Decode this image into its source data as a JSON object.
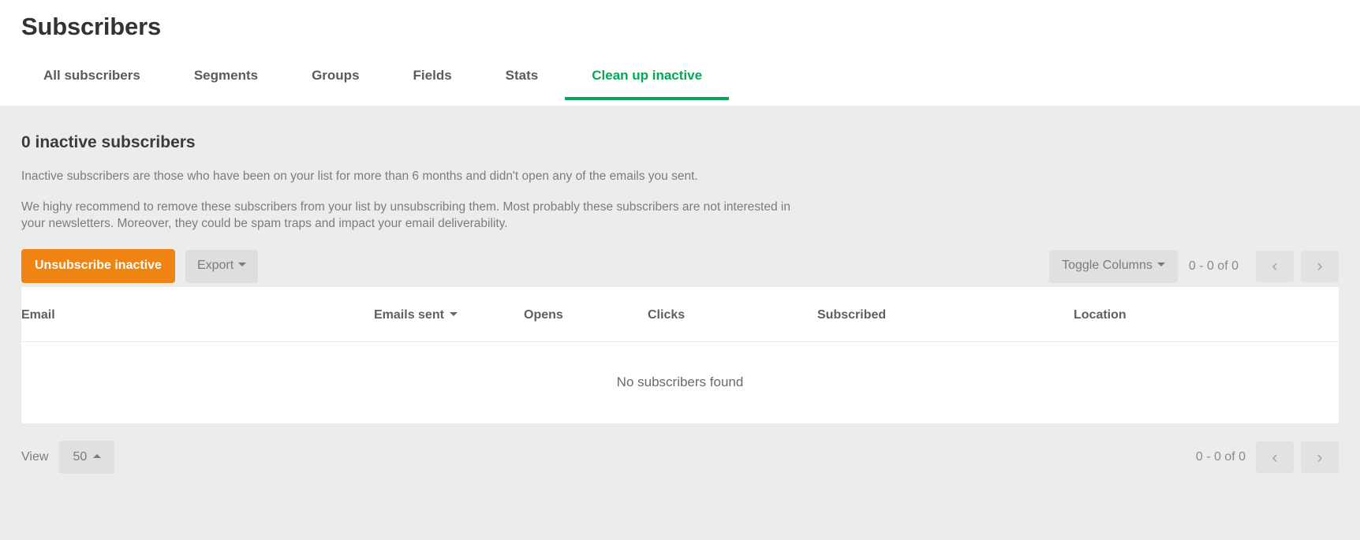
{
  "header": {
    "title": "Subscribers",
    "tabs": [
      {
        "label": "All subscribers",
        "active": false
      },
      {
        "label": "Segments",
        "active": false
      },
      {
        "label": "Groups",
        "active": false
      },
      {
        "label": "Fields",
        "active": false
      },
      {
        "label": "Stats",
        "active": false
      },
      {
        "label": "Clean up inactive",
        "active": true
      }
    ]
  },
  "main": {
    "section_title": "0 inactive subscribers",
    "paragraph_1": "Inactive subscribers are those who have been on your list for more than 6 months and didn't open any of the emails you sent.",
    "paragraph_2": "We highy recommend to remove these subscribers from your list by unsubscribing them. Most probably these subscribers are not interested in your newsletters. Moreover, they could be spam traps and impact your email deliverability."
  },
  "toolbar": {
    "unsubscribe_label": "Unsubscribe inactive",
    "export_label": "Export",
    "toggle_columns_label": "Toggle Columns",
    "range_text": "0 - 0 of 0",
    "prev_icon": "‹",
    "next_icon": "›"
  },
  "table": {
    "columns": [
      {
        "label": "Email",
        "sortable": false
      },
      {
        "label": "Emails sent",
        "sortable": true
      },
      {
        "label": "Opens",
        "sortable": false
      },
      {
        "label": "Clicks",
        "sortable": false
      },
      {
        "label": "Subscribed",
        "sortable": false
      },
      {
        "label": "Location",
        "sortable": false
      }
    ],
    "rows": [],
    "empty_message": "No subscribers found"
  },
  "footer": {
    "view_label": "View",
    "page_size": "50",
    "range_text": "0 - 0 of 0",
    "prev_icon": "‹",
    "next_icon": "›"
  },
  "colors": {
    "accent_orange": "#ef8413",
    "accent_green": "#06a65a",
    "page_background": "#ececec",
    "card_background": "#ffffff"
  }
}
